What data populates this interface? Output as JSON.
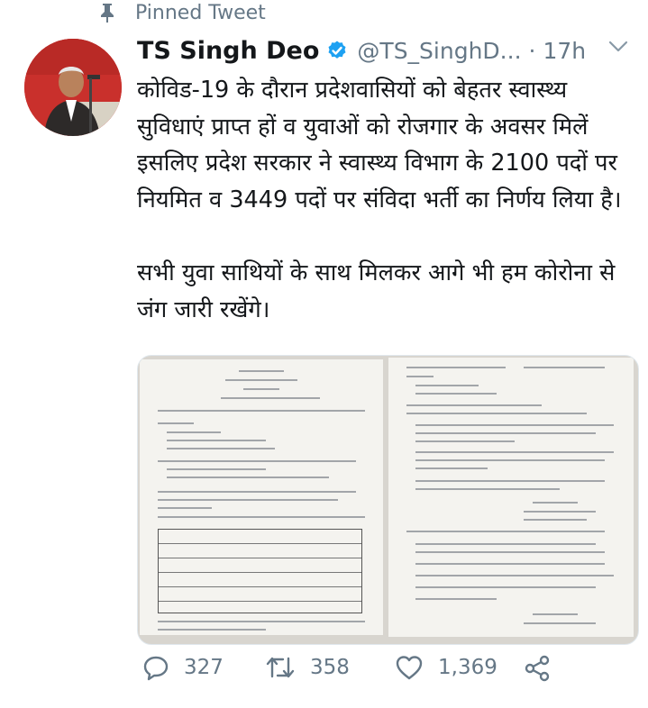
{
  "pinned": {
    "label": "Pinned Tweet",
    "icon": "pin-icon"
  },
  "tweet": {
    "author_name": "TS Singh Deo",
    "verified": true,
    "handle": "@TS_SinghD...",
    "separator": "·",
    "time": "17h",
    "paragraphs": [
      "कोविड-19 के दौरान प्रदेशवासियों को बेहतर स्वास्थ्य सुविधाएं प्राप्त हों व युवाओं को रोजगार के अवसर मिलें इसलिए प्रदेश सरकार ने स्वास्थ्य विभाग के 2100 पदों पर नियमित व 3449 पदों पर संविदा भर्ती का निर्णय लिया है।",
      "सभी युवा साथियों के साथ मिलकर आगे भी हम कोरोना से जंग जारी रखेंगे।"
    ],
    "media": {
      "count": 2
    }
  },
  "actions": {
    "reply_count": "327",
    "retweet_count": "358",
    "like_count": "1,369"
  },
  "colors": {
    "text": "#14171a",
    "secondary": "#657786",
    "verified": "#1da1f2"
  }
}
